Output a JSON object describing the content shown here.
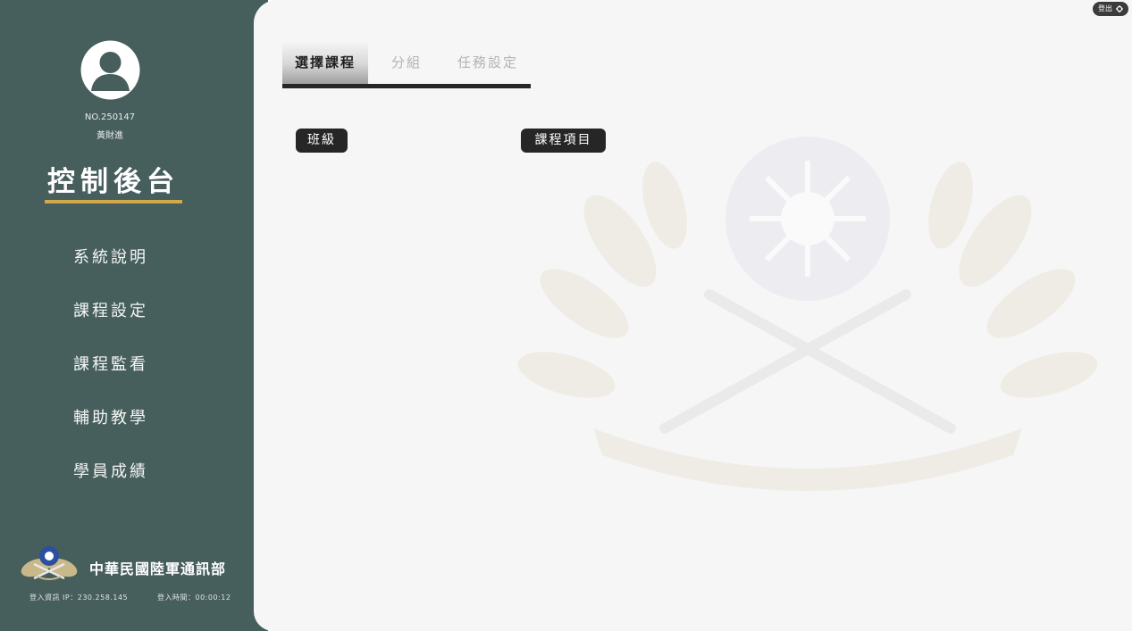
{
  "user": {
    "number": "NO.250147",
    "name": "黃財進"
  },
  "sidebar": {
    "title": "控制後台",
    "nav": [
      {
        "label": "系統說明"
      },
      {
        "label": "課程設定"
      },
      {
        "label": "課程監看"
      },
      {
        "label": "輔助教學"
      },
      {
        "label": "學員成績"
      }
    ],
    "org_name": "中華民國陸軍通訊部",
    "login_ip": "登入資訊 IP：230.258.145",
    "login_time": "登入時間：00:00:12"
  },
  "tabs": [
    {
      "label": "選擇課程",
      "active": true
    },
    {
      "label": "分組",
      "active": false
    },
    {
      "label": "任務設定",
      "active": false
    }
  ],
  "main": {
    "class_label": "班級",
    "course_items_label": "課程項目"
  },
  "header": {
    "logout_label": "登出",
    "logout_icon": "gear-icon"
  },
  "colors": {
    "sidebar_bg": "#465e5c",
    "accent_gold": "#d1a94a",
    "main_bg": "#f6f6f6",
    "dark": "#262626"
  }
}
